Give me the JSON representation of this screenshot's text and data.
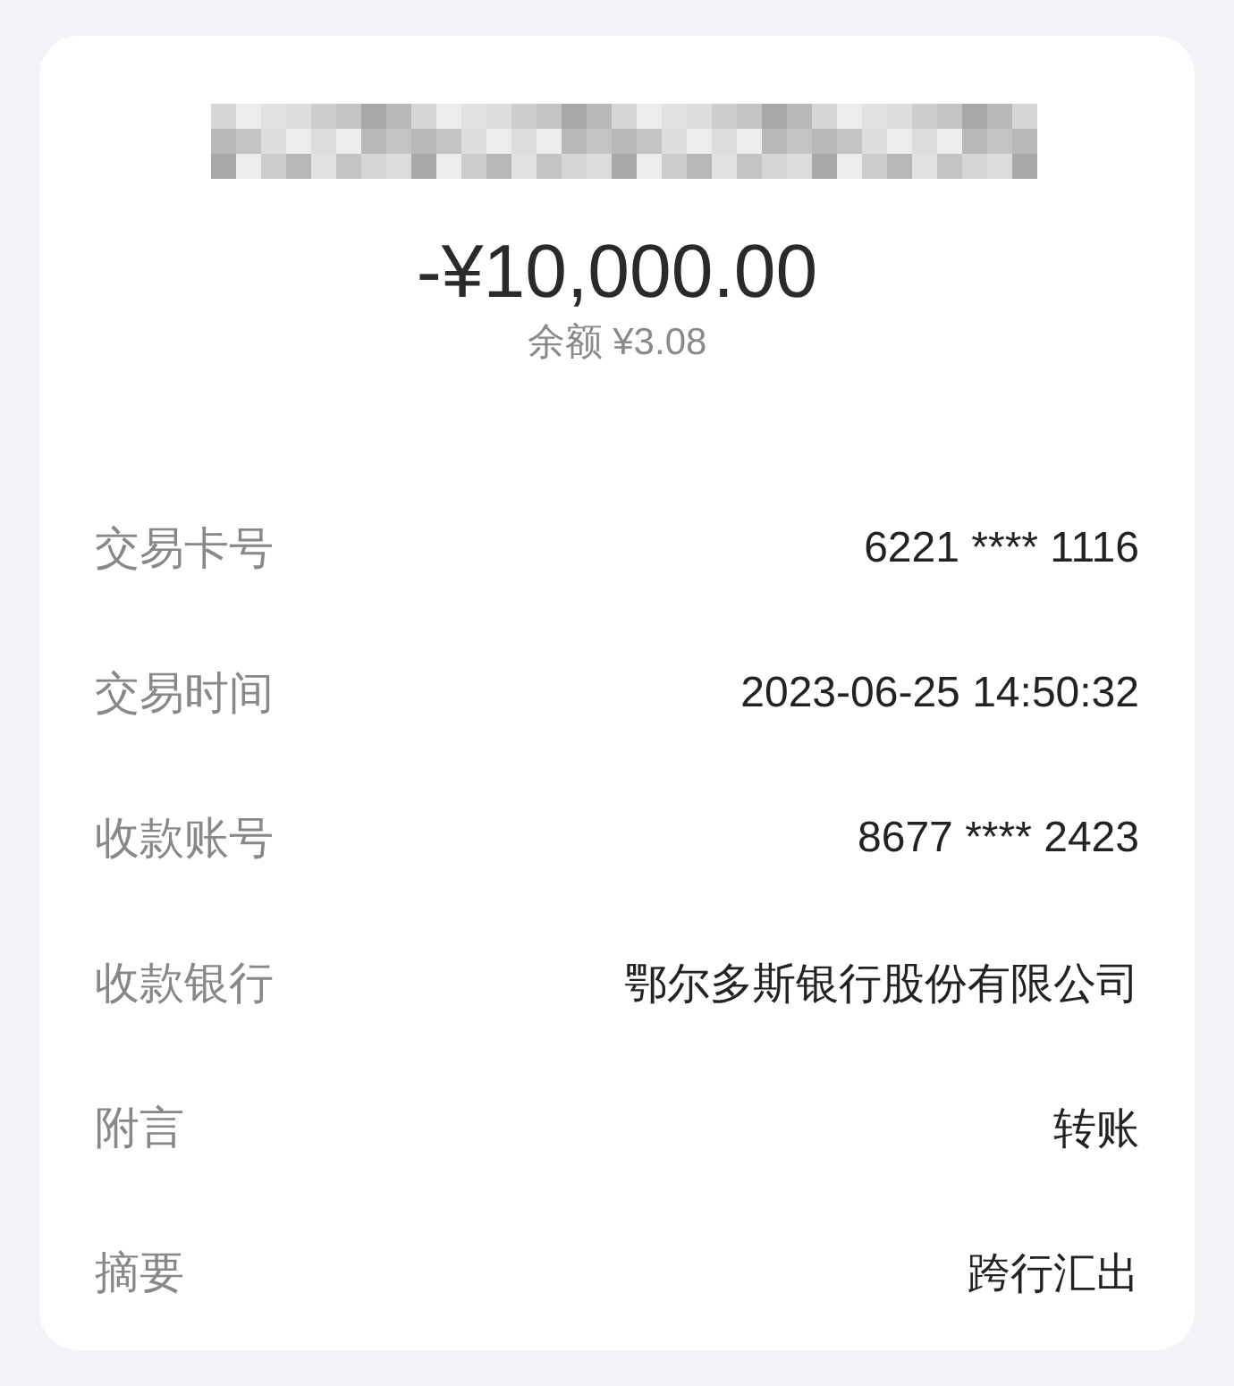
{
  "amount": "-¥10,000.00",
  "balance": "余额 ¥3.08",
  "details": [
    {
      "label": "交易卡号",
      "value": "6221 **** 1116"
    },
    {
      "label": "交易时间",
      "value": "2023-06-25 14:50:32"
    },
    {
      "label": "收款账号",
      "value": "8677 **** 2423"
    },
    {
      "label": "收款银行",
      "value": "鄂尔多斯银行股份有限公司"
    },
    {
      "label": "附言",
      "value": "转账"
    },
    {
      "label": "摘要",
      "value": "跨行汇出"
    }
  ]
}
